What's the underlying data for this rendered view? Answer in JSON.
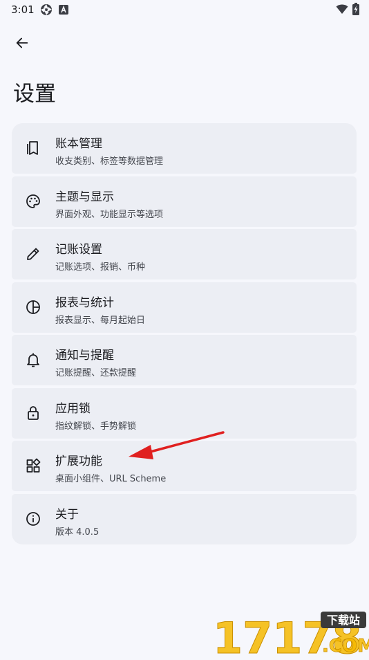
{
  "status_bar": {
    "time": "3:01",
    "app_icons": [
      "aperture-icon",
      "letter-a-icon"
    ],
    "system_icons": [
      "wifi-icon",
      "battery-charging-icon"
    ]
  },
  "header": {
    "back_icon": "arrow-back-icon",
    "title": "设置"
  },
  "settings": {
    "items": [
      {
        "icon": "ledger-book-icon",
        "title": "账本管理",
        "subtitle": "收支类别、标签等数据管理"
      },
      {
        "icon": "palette-icon",
        "title": "主题与显示",
        "subtitle": "界面外观、功能显示等选项"
      },
      {
        "icon": "pencil-icon",
        "title": "记账设置",
        "subtitle": "记账选项、报销、币种"
      },
      {
        "icon": "pie-chart-icon",
        "title": "报表与统计",
        "subtitle": "报表显示、每月起始日"
      },
      {
        "icon": "bell-icon",
        "title": "通知与提醒",
        "subtitle": "记账提醒、还款提醒"
      },
      {
        "icon": "lock-icon",
        "title": "应用锁",
        "subtitle": "指纹解锁、手势解锁"
      },
      {
        "icon": "widgets-icon",
        "title": "扩展功能",
        "subtitle": "桌面小组件、URL Scheme"
      },
      {
        "icon": "info-icon",
        "title": "关于",
        "subtitle": "版本 4.0.5"
      }
    ]
  },
  "watermark": {
    "digits": "17178",
    "badge": "下载站",
    "domain": ".COM"
  },
  "colors": {
    "background": "#f6f7fc",
    "card": "#eceef4",
    "text": "#1b1c20",
    "subtext": "#44474e",
    "annotation_arrow": "#e02020",
    "watermark_accent": "#f5b800"
  }
}
